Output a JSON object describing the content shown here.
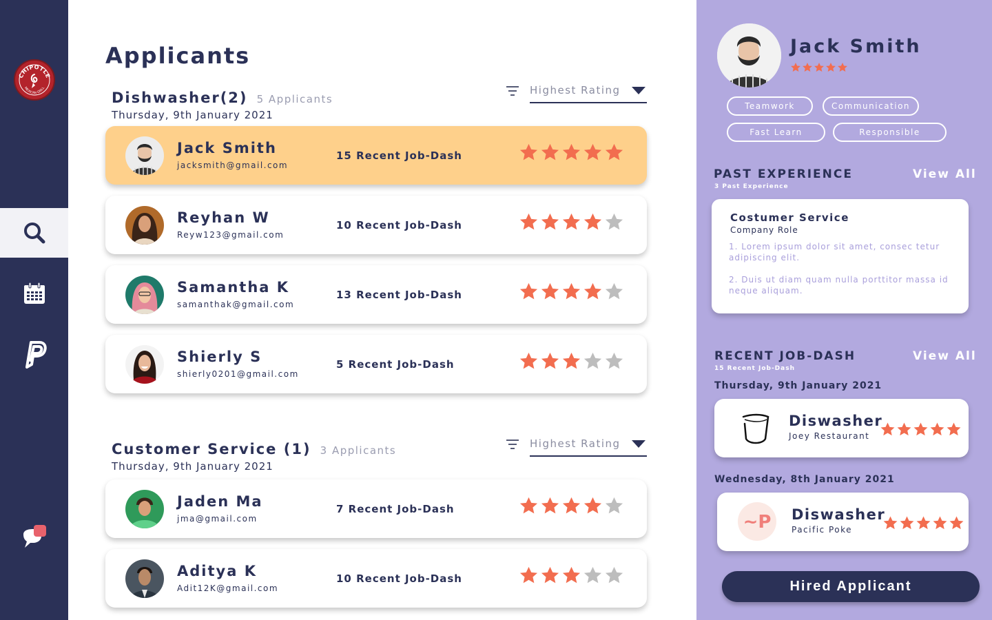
{
  "brand": {
    "name": "CHIPOTLE",
    "sub": "MEXICAN GRILL"
  },
  "sidebar": {
    "items": [
      {
        "name": "search",
        "icon": "search-icon",
        "active": true
      },
      {
        "name": "calendar",
        "icon": "calendar-icon",
        "active": false
      },
      {
        "name": "payments",
        "icon": "paypal-icon",
        "active": false
      },
      {
        "name": "messages",
        "icon": "chat-notification-icon",
        "active": false
      }
    ]
  },
  "main": {
    "title": "Applicants",
    "sections": [
      {
        "title": "Dishwasher(2)",
        "count": "5 Applicants",
        "date": "Thursday, 9th January 2021",
        "sort_label": "Highest Rating",
        "applicants": [
          {
            "name": "Jack Smith",
            "email": "jacksmith@gmail.com",
            "jobs": "15 Recent Job-Dash",
            "rating": 5,
            "selected": true
          },
          {
            "name": "Reyhan W",
            "email": "Reyw123@gmail.com",
            "jobs": "10 Recent Job-Dash",
            "rating": 4
          },
          {
            "name": "Samantha K",
            "email": "samanthak@gmail.com",
            "jobs": "13 Recent Job-Dash",
            "rating": 4
          },
          {
            "name": "Shierly S",
            "email": "shierly0201@gmail.com",
            "jobs": "5 Recent Job-Dash",
            "rating": 3
          }
        ]
      },
      {
        "title": "Customer Service (1)",
        "count": "3 Applicants",
        "date": "Thursday, 9th January 2021",
        "sort_label": "Highest Rating",
        "applicants": [
          {
            "name": "Jaden Ma",
            "email": "jma@gmail.com",
            "jobs": "7 Recent Job-Dash",
            "rating": 4
          },
          {
            "name": "Aditya K",
            "email": "Adit12K@gmail.com",
            "jobs": "10 Recent Job-Dash",
            "rating": 3
          }
        ]
      }
    ]
  },
  "profile": {
    "name": "Jack Smith",
    "rating": 5,
    "tags": [
      "Teamwork",
      "Communication",
      "Fast Learn",
      "Responsible"
    ],
    "past_experience": {
      "title": "PAST EXPERIENCE",
      "subtitle": "3 Past Experience",
      "view_all": "View All",
      "card": {
        "title": "Costumer Service",
        "role": "Company Role",
        "lines": [
          "1. Lorem ipsum dolor sit amet, consec tetur adipiscing elit.",
          "2. Duis ut diam quam nulla porttitor massa id neque aliquam."
        ]
      }
    },
    "recent_jobs": {
      "title": "RECENT JOB-DASH",
      "subtitle": "15 Recent Job-Dash",
      "view_all": "View All",
      "items": [
        {
          "date": "Thursday, 9th January 2021",
          "title": "Diswasher",
          "place": "Joey Restaurant",
          "rating": 5,
          "logo": "joey-restaurant-logo"
        },
        {
          "date": "Wednesday, 8th January 2021",
          "title": "Diswasher",
          "place": "Pacific Poke",
          "rating": 5,
          "logo": "pacific-poke-logo",
          "logo_text": "~P"
        }
      ]
    },
    "hire_button": "Hired Applicant"
  },
  "colors": {
    "sidebar": "#2b3157",
    "accent": "#fed08b",
    "panel": "#b2a9df",
    "star": "#f26d4f",
    "star_empty": "#bdbdbd"
  }
}
